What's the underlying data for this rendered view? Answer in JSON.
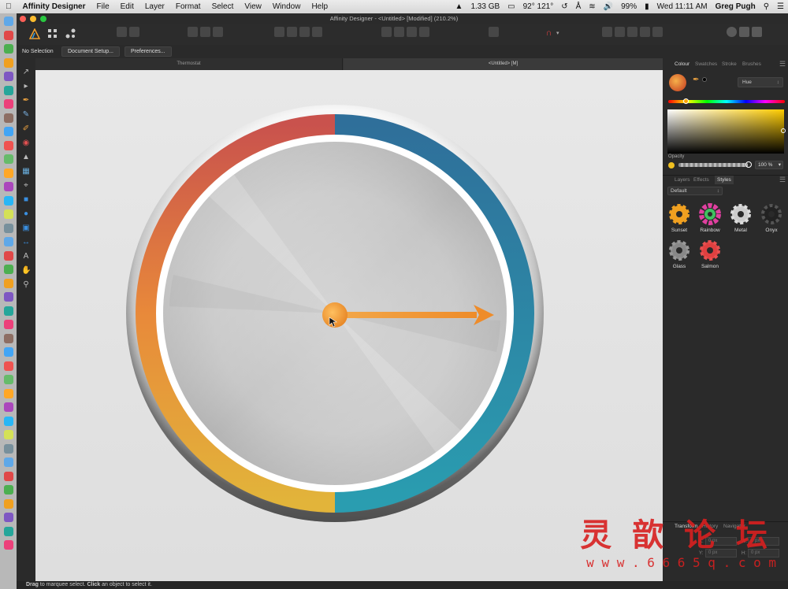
{
  "menubar": {
    "app_name": "Affinity Designer",
    "items": [
      "File",
      "Edit",
      "Layer",
      "Format",
      "Select",
      "View",
      "Window",
      "Help"
    ],
    "status_items": [
      "1.33 GB",
      "92° 121°",
      "99%",
      "Wed 11:11 AM",
      "Greg Pugh"
    ]
  },
  "window": {
    "title": "Affinity Designer - <Untitled> [Modified] (210.2%)"
  },
  "context_toolbar": {
    "selection_label": "No Selection",
    "document_setup_label": "Document Setup...",
    "preferences_label": "Preferences..."
  },
  "document_tabs": [
    {
      "label": "Thermostat"
    },
    {
      "label": "<Untitled> [M]"
    }
  ],
  "panel": {
    "colour_tabs": [
      "Colour",
      "Swatches",
      "Stroke",
      "Brushes"
    ],
    "colour_model": "Hue",
    "opacity_label": "Opacity",
    "opacity_value": "100 %",
    "mid_tabs": [
      "Layers",
      "Effects",
      "Styles"
    ],
    "styles_category": "Default",
    "styles": [
      {
        "name": "Sunset"
      },
      {
        "name": "Rainbow"
      },
      {
        "name": "Metal"
      },
      {
        "name": "Onyx"
      },
      {
        "name": "Glass"
      },
      {
        "name": "Salmon"
      }
    ],
    "bottom_tabs": [
      "Transform",
      "History",
      "Navigator"
    ],
    "transform_fields": [
      "X:",
      "W:",
      "Y:",
      "H:"
    ],
    "transform_values": [
      "0 px",
      "0 px",
      "0 px",
      "0 px"
    ]
  },
  "statusbar": {
    "drag_word": "Drag",
    "drag_text": " to marquee select. ",
    "click_word": "Click",
    "click_text": " an object to select it."
  },
  "watermark": {
    "chars": "灵 歆 论 坛",
    "url": "w w w . 6 6 6 5 q . c o m"
  },
  "colors": {
    "arc_red": "#c9524d",
    "arc_blue": "#2f6f9a",
    "arc_teal": "#2a93ab",
    "arc_yellow": "#e2b43a",
    "arc_orange": "#e8893a",
    "accent_orange": "#f0983c"
  }
}
